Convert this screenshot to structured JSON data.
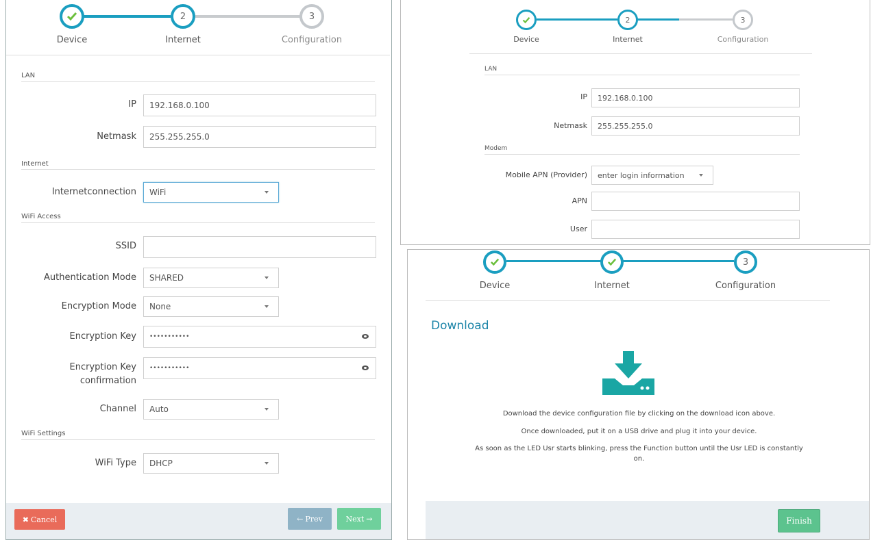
{
  "colors": {
    "accent": "#1a9ec0",
    "check": "#6bbf3c",
    "pending": "#c4c8cc",
    "cancel": "#e96b5a",
    "prev": "#8fb3c6",
    "next": "#6fd09c",
    "finish": "#5cc38e",
    "download_icon": "#1aa6a4"
  },
  "left": {
    "steps": [
      {
        "label": "Device",
        "state": "done",
        "number": ""
      },
      {
        "label": "Internet",
        "state": "active",
        "number": "2"
      },
      {
        "label": "Configuration",
        "state": "pending",
        "number": "3"
      }
    ],
    "sections": {
      "lan": "LAN",
      "internet": "Internet",
      "wifi_access": "WiFi Access",
      "wifi_settings": "WiFi Settings"
    },
    "fields": {
      "ip": {
        "label": "IP",
        "value": "192.168.0.100"
      },
      "netmask": {
        "label": "Netmask",
        "value": "255.255.255.0"
      },
      "internetconnection": {
        "label": "Internetconnection",
        "value": "WiFi"
      },
      "ssid": {
        "label": "SSID",
        "value": ""
      },
      "auth_mode": {
        "label": "Authentication Mode",
        "value": "SHARED"
      },
      "enc_mode": {
        "label": "Encryption Mode",
        "value": "None"
      },
      "enc_key": {
        "label": "Encryption Key",
        "value": "•••••••••••"
      },
      "enc_key_conf": {
        "label": "Encryption Key confirmation",
        "value": "•••••••••••"
      },
      "channel": {
        "label": "Channel",
        "value": "Auto"
      },
      "wifi_type": {
        "label": "WiFi Type",
        "value": "DHCP"
      }
    },
    "buttons": {
      "cancel": "Cancel",
      "prev": "Prev",
      "next": "Next"
    }
  },
  "top_right": {
    "steps": [
      {
        "label": "Device",
        "state": "done",
        "number": ""
      },
      {
        "label": "Internet",
        "state": "active",
        "number": "2"
      },
      {
        "label": "Configuration",
        "state": "pending",
        "number": "3"
      }
    ],
    "sections": {
      "lan": "LAN",
      "modem": "Modem"
    },
    "fields": {
      "ip": {
        "label": "IP",
        "value": "192.168.0.100"
      },
      "netmask": {
        "label": "Netmask",
        "value": "255.255.255.0"
      },
      "mobile_apn": {
        "label": "Mobile APN (Provider)",
        "value": "enter login information"
      },
      "apn": {
        "label": "APN",
        "value": ""
      },
      "user": {
        "label": "User",
        "value": ""
      }
    }
  },
  "bottom_right": {
    "steps": [
      {
        "label": "Device",
        "state": "done",
        "number": ""
      },
      {
        "label": "Internet",
        "state": "done",
        "number": ""
      },
      {
        "label": "Configuration",
        "state": "active",
        "number": "3"
      }
    ],
    "title": "Download",
    "lines": [
      "Download the device configuration file by clicking on the download icon above.",
      "Once downloaded, put it on a USB drive and plug it into your device.",
      "As soon as the LED Usr starts blinking, press the Function button until the Usr LED is constantly on."
    ],
    "finish_label": "Finish"
  }
}
